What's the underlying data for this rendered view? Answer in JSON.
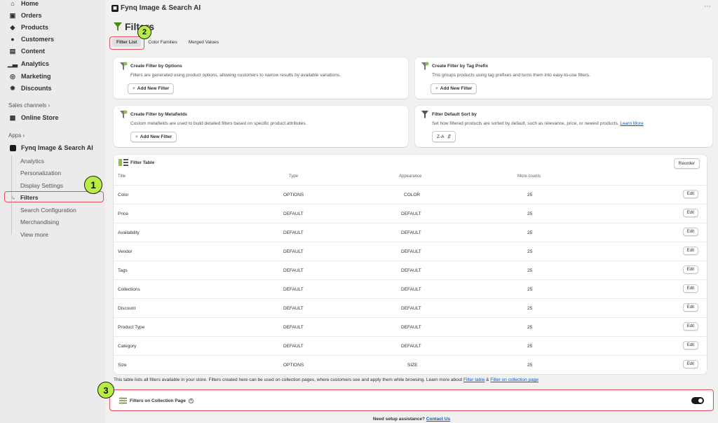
{
  "sidebar": {
    "items": [
      {
        "label": "Home",
        "icon": "home-icon"
      },
      {
        "label": "Orders",
        "icon": "inbox-icon"
      },
      {
        "label": "Products",
        "icon": "tag-icon"
      },
      {
        "label": "Customers",
        "icon": "person-icon"
      },
      {
        "label": "Content",
        "icon": "content-icon"
      },
      {
        "label": "Analytics",
        "icon": "bar-chart-icon"
      },
      {
        "label": "Marketing",
        "icon": "target-icon"
      },
      {
        "label": "Discounts",
        "icon": "gear-badge-icon"
      }
    ],
    "sales_channels_label": "Sales channels",
    "online_store_label": "Online Store",
    "apps_label": "Apps",
    "app_name": "Fynq Image & Search AI",
    "sub_items": [
      "Analytics",
      "Personalization",
      "Display Settings",
      "Filters",
      "Search Configuration",
      "Merchandising",
      "View more"
    ]
  },
  "header": {
    "app_title": "Fynq Image & Search AI",
    "more_icon": "ellipsis-icon"
  },
  "page": {
    "title": "Filters"
  },
  "tabs": [
    "Filter List",
    "Color Families",
    "Merged Values"
  ],
  "cards": {
    "options": {
      "title": "Create Filter by Options",
      "desc": "Filters are generated using product options, allowing customers to narrow results by available variations.",
      "button": "Add New Filter"
    },
    "tag_prefix": {
      "title": "Create Filter by Tag Prefix",
      "desc": "This groups products using tag prefixes and turns them into easy-to-use filters.",
      "button": "Add New Filter"
    },
    "metafields": {
      "title": "Create Filter by Metafields",
      "desc": "Custom metafields are used to build detailed filters based on specific product attributes.",
      "button": "Add New Filter"
    },
    "sort": {
      "title": "Filter Default Sort by",
      "desc": "Set how filtered products are sorted by default, such as relevance, price, or newest products.",
      "link": "Learn More",
      "select_value": "Z-A"
    }
  },
  "filter_table": {
    "title": "Filter Table",
    "reorder_label": "Reorder",
    "columns": [
      "Title",
      "Type",
      "Appearance",
      "More counts"
    ],
    "edit_label": "Edit",
    "rows": [
      [
        "Color",
        "OPTIONS",
        "COLOR",
        "25"
      ],
      [
        "Price",
        "DEFAULT",
        "DEFAULT",
        "25"
      ],
      [
        "Availability",
        "DEFAULT",
        "DEFAULT",
        "25"
      ],
      [
        "Vendor",
        "DEFAULT",
        "DEFAULT",
        "25"
      ],
      [
        "Tags",
        "DEFAULT",
        "DEFAULT",
        "25"
      ],
      [
        "Collections",
        "DEFAULT",
        "DEFAULT",
        "25"
      ],
      [
        "Discount",
        "DEFAULT",
        "DEFAULT",
        "25"
      ],
      [
        "Product Type",
        "DEFAULT",
        "DEFAULT",
        "25"
      ],
      [
        "Category",
        "DEFAULT",
        "DEFAULT",
        "25"
      ],
      [
        "Size",
        "OPTIONS",
        "SIZE",
        "25"
      ]
    ]
  },
  "footnote": {
    "text": "This table lists all filters available in your store. Filters created here can be used on collection pages, where customers see and apply them while browsing. Learn more about",
    "link1": "Filter table",
    "amp": "&",
    "link2": "Filter on collection page"
  },
  "collection_page": {
    "label": "Filters on Collection Page",
    "toggle_on": true
  },
  "assist": {
    "text": "Need setup assistance?",
    "link": "Contact Us"
  },
  "annotations": [
    "1",
    "2",
    "3"
  ],
  "colors": {
    "accent_green": "#b8ee44",
    "highlight_red": "#e05260",
    "link_blue": "#005bd3"
  }
}
